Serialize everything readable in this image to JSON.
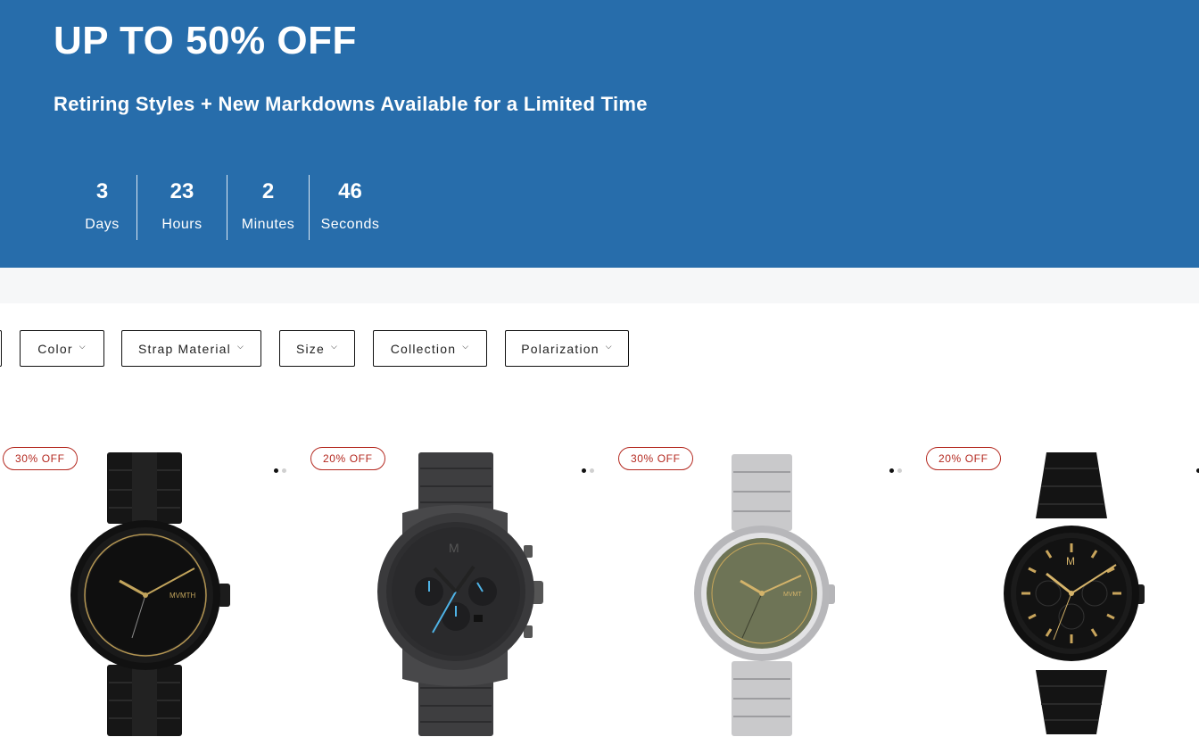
{
  "hero": {
    "title": "UP TO 50% OFF",
    "subtitle": "Retiring Styles + New Markdowns Available for a Limited Time",
    "background": "#276dab",
    "countdown": [
      {
        "value": "3",
        "label": "Days"
      },
      {
        "value": "23",
        "label": "Hours"
      },
      {
        "value": "2",
        "label": "Minutes"
      },
      {
        "value": "46",
        "label": "Seconds"
      }
    ]
  },
  "filters": [
    {
      "label": "Color"
    },
    {
      "label": "Strap Material"
    },
    {
      "label": "Size"
    },
    {
      "label": "Collection"
    },
    {
      "label": "Polarization"
    }
  ],
  "products": [
    {
      "badge": "30% OFF",
      "watch_icon": "black-gold-watch-icon",
      "active_image": 1,
      "image_count": 2
    },
    {
      "badge": "20% OFF",
      "watch_icon": "gunmetal-chronograph-watch-icon",
      "active_image": 1,
      "image_count": 2
    },
    {
      "badge": "30% OFF",
      "watch_icon": "silver-olive-watch-icon",
      "active_image": 1,
      "image_count": 2
    },
    {
      "badge": "20% OFF",
      "watch_icon": "black-gold-chronograph-watch-icon",
      "active_image": 1,
      "image_count": 2
    }
  ],
  "colors": {
    "badge": "#b4281f",
    "hero": "#276dab",
    "strip": "#f6f7f8"
  }
}
